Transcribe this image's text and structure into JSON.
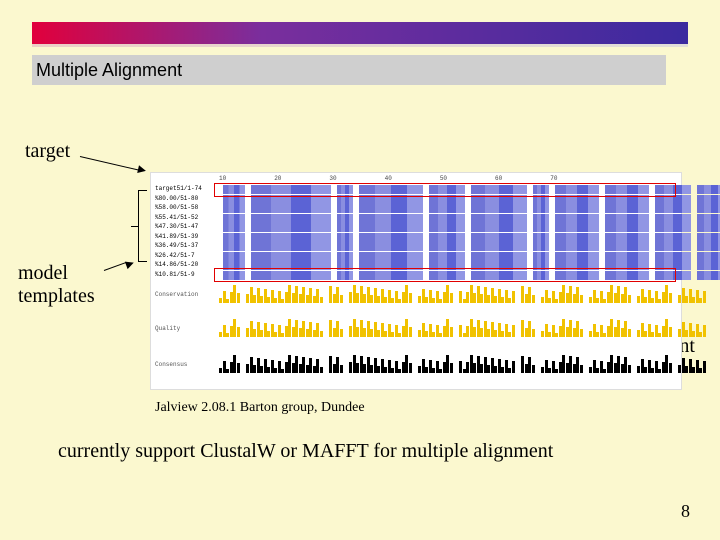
{
  "header": {
    "title": "Multiple Alignment"
  },
  "labels": {
    "target": "target",
    "model_templates": "model\ntemplates",
    "pairwise": "pairwise\nalignment"
  },
  "figure": {
    "caption": "Jalview 2.08.1 Barton group, Dundee",
    "ruler_ticks": [
      "10",
      "20",
      "30",
      "40",
      "50",
      "60",
      "70"
    ],
    "sequences": [
      "target51/1-74",
      "%80.00/51-80",
      "%58.00/51-58",
      "%55.41/51-52",
      "%47.30/51-47",
      "%41.89/51-39",
      "%36.49/51-37",
      "%26.42/51-7",
      "%14.86/51-20",
      "%10.81/51-9"
    ],
    "tracks": {
      "conservation": "Conservation",
      "quality": "Quality",
      "consensus": "Consensus"
    },
    "block_widths": [
      22,
      80,
      16,
      64,
      36,
      56,
      16,
      44,
      44,
      36,
      28
    ]
  },
  "body": {
    "support_line": "currently support ClustalW or MAFFT for multiple alignment"
  },
  "page_number": "8"
}
